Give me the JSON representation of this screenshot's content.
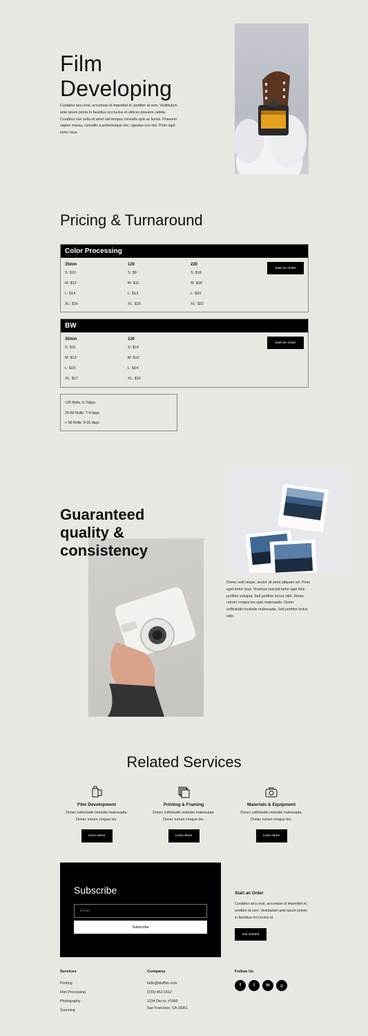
{
  "hero": {
    "title_line1": "Film",
    "title_line2": "Developing",
    "text": "Curabitur arcu erat, accumsan id imperdiet et, porttitor at sem. Vestibulum ante ipsum primis in faucibus orci luctus et ultrices posuere cubilia. Curabitur non nulla sit amet nisl tempus convallis quis ac lectus. Praesent sapien massa, convallis a pellentesque nec, egestas non nisi. Proin eget tortor risus."
  },
  "pricing": {
    "title": "Pricing & Turnaround",
    "button_label": "Start an Order",
    "color": {
      "heading": "Color Processing",
      "columns": [
        {
          "name": "35mm",
          "rows": [
            "S: $10",
            "M: $12",
            "L: $14",
            "XL: $16"
          ]
        },
        {
          "name": "120",
          "rows": [
            "S: $9",
            "M: $11",
            "L: $13",
            "XL: $15"
          ]
        },
        {
          "name": "220",
          "rows": [
            "S: $16",
            "M: $18",
            "L: $20",
            "XL: $22"
          ]
        }
      ]
    },
    "bw": {
      "heading": "BW",
      "columns": [
        {
          "name": "35mm",
          "rows": [
            "S: $11",
            "M: $13",
            "L: $15",
            "XL: $17"
          ]
        },
        {
          "name": "120",
          "rows": [
            "S: $10",
            "M: $12",
            "L: $14",
            "XL: $16"
          ]
        }
      ]
    },
    "turnaround": [
      "<25 Rolls: 5-7days",
      "25-50 Rolls: 7-9 days",
      "> 50 Rolls: 9-15 days"
    ]
  },
  "quality": {
    "title_line1": "Guaranteed",
    "title_line2": "quality &",
    "title_line3": "consistency",
    "text": "Donec velit neque, auctor sit amet aliquam vel. Proin eget tortor risus. Vivamus suscipit tortor eget felis porttitor volutpat. Sed porttitor lectus nibh. Donec rutrum congue leo eget malesuada. Donec sollicitudin molestie malesuada. Sed porttitor lectus nibh."
  },
  "related": {
    "title": "Related Services",
    "items": [
      {
        "icon": "film-canister-icon",
        "title": "Film Development",
        "desc1": "Donec sollicitudin molestie malesuada.",
        "desc2": "Donec rutrum congue leo.",
        "button": "Learn More"
      },
      {
        "icon": "stacked-frames-icon",
        "title": "Printing & Framing",
        "desc1": "Donec sollicitudin molestie malesuada.",
        "desc2": "Donec rutrum congue leo.",
        "button": "Learn More"
      },
      {
        "icon": "camera-bag-icon",
        "title": "Materials & Equipment",
        "desc1": "Donec sollicitudin molestie malesuada.",
        "desc2": "Donec rutrum congue leo.",
        "button": "Learn More"
      }
    ]
  },
  "subscribe": {
    "title": "Subscribe",
    "email_placeholder": "Email",
    "button": "Subscribe"
  },
  "start_order": {
    "title": "Start an Order",
    "text": "Curabitur arcu erat, accumsan id imperdiet et, porttitor at sem. Vestibulum ante ipsum primis in faucibus orci luctus et",
    "button": "Get Started"
  },
  "footer": {
    "services_heading": "Services",
    "services": [
      "Printing",
      "Film Processing",
      "Photography",
      "Scanning"
    ],
    "company_heading": "Company",
    "email": "hello@diviflim.com",
    "phone": "(235)-462-1512",
    "address1": "1234 Divi st. #1000",
    "address2": "San Francisco, CA 19351",
    "follow_heading": "Follow Us",
    "social": [
      {
        "icon": "facebook-icon",
        "glyph": "f"
      },
      {
        "icon": "twitter-icon",
        "glyph": "t"
      },
      {
        "icon": "linkedin-icon",
        "glyph": "in"
      },
      {
        "icon": "instagram-icon",
        "glyph": "◎"
      }
    ]
  },
  "colors": {
    "background": "#e9e7e2",
    "black": "#000000",
    "white": "#ffffff"
  }
}
